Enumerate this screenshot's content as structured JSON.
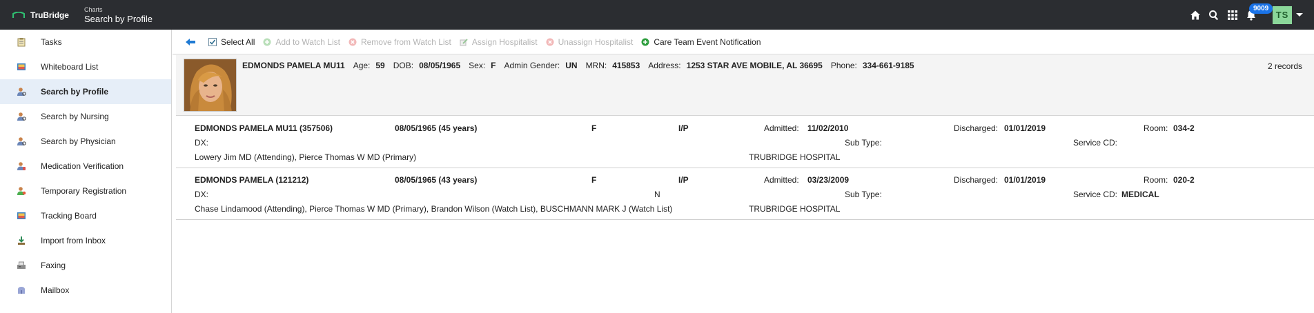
{
  "header": {
    "logo_text": "TruBridge",
    "breadcrumb_parent": "Charts",
    "page_title": "Search by Profile",
    "notification_count": "9009",
    "user_initials": "TS"
  },
  "sidebar": {
    "items": [
      {
        "label": "Tasks",
        "icon": "clipboard-icon"
      },
      {
        "label": "Whiteboard List",
        "icon": "whiteboard-icon"
      },
      {
        "label": "Search by Profile",
        "icon": "person-search-icon",
        "active": true
      },
      {
        "label": "Search by Nursing",
        "icon": "nurse-icon"
      },
      {
        "label": "Search by Physician",
        "icon": "physician-icon"
      },
      {
        "label": "Medication Verification",
        "icon": "medication-icon"
      },
      {
        "label": "Temporary Registration",
        "icon": "registration-icon"
      },
      {
        "label": "Tracking Board",
        "icon": "tracking-board-icon"
      },
      {
        "label": "Import from Inbox",
        "icon": "import-icon"
      },
      {
        "label": "Faxing",
        "icon": "fax-icon"
      },
      {
        "label": "Mailbox",
        "icon": "mailbox-icon"
      }
    ]
  },
  "toolbar": {
    "select_all": "Select All",
    "add_watch": "Add to Watch List",
    "remove_watch": "Remove from Watch List",
    "assign_hospitalist": "Assign Hospitalist",
    "unassign_hospitalist": "Unassign Hospitalist",
    "care_team": "Care Team Event Notification"
  },
  "patient": {
    "name": "EDMONDS PAMELA MU11",
    "age_label": "Age:",
    "age": "59",
    "dob_label": "DOB:",
    "dob": "08/05/1965",
    "sex_label": "Sex:",
    "sex": "F",
    "gender_label": "Admin Gender:",
    "gender": "UN",
    "mrn_label": "MRN:",
    "mrn": "415853",
    "address_label": "Address:",
    "address": "1253 STAR AVE MOBILE, AL 36695",
    "phone_label": "Phone:",
    "phone": "334-661-9185",
    "records": "2 records"
  },
  "visits": [
    {
      "name": "EDMONDS PAMELA MU11 (357506)",
      "dob_age": "08/05/1965 (45 years)",
      "sex": "F",
      "type": "I/P",
      "admitted_label": "Admitted:",
      "admitted": "11/02/2010",
      "discharged_label": "Discharged:",
      "discharged": "01/01/2019",
      "room_label": "Room:",
      "room": "034-2",
      "dx_label": "DX:",
      "dx_flag": "",
      "subtype_label": "Sub Type:",
      "subtype": "",
      "service_label": "Service CD:",
      "service": "",
      "providers": "Lowery Jim MD (Attending), Pierce Thomas W MD (Primary)",
      "facility": "TRUBRIDGE HOSPITAL"
    },
    {
      "name": "EDMONDS PAMELA (121212)",
      "dob_age": "08/05/1965 (43 years)",
      "sex": "F",
      "type": "I/P",
      "admitted_label": "Admitted:",
      "admitted": "03/23/2009",
      "discharged_label": "Discharged:",
      "discharged": "01/01/2019",
      "room_label": "Room:",
      "room": "020-2",
      "dx_label": "DX:",
      "dx_flag": "N",
      "subtype_label": "Sub Type:",
      "subtype": "",
      "service_label": "Service CD:",
      "service": "MEDICAL",
      "providers": "Chase Lindamood (Attending), Pierce Thomas W MD (Primary), Brandon Wilson (Watch List), BUSCHMANN MARK J (Watch List)",
      "facility": "TRUBRIDGE HOSPITAL"
    }
  ],
  "colors": {
    "topbar": "#2b2d31",
    "accent_blue": "#1a73e8",
    "avatar_bg": "#8bd79a",
    "active_row": "#e6eef8"
  }
}
